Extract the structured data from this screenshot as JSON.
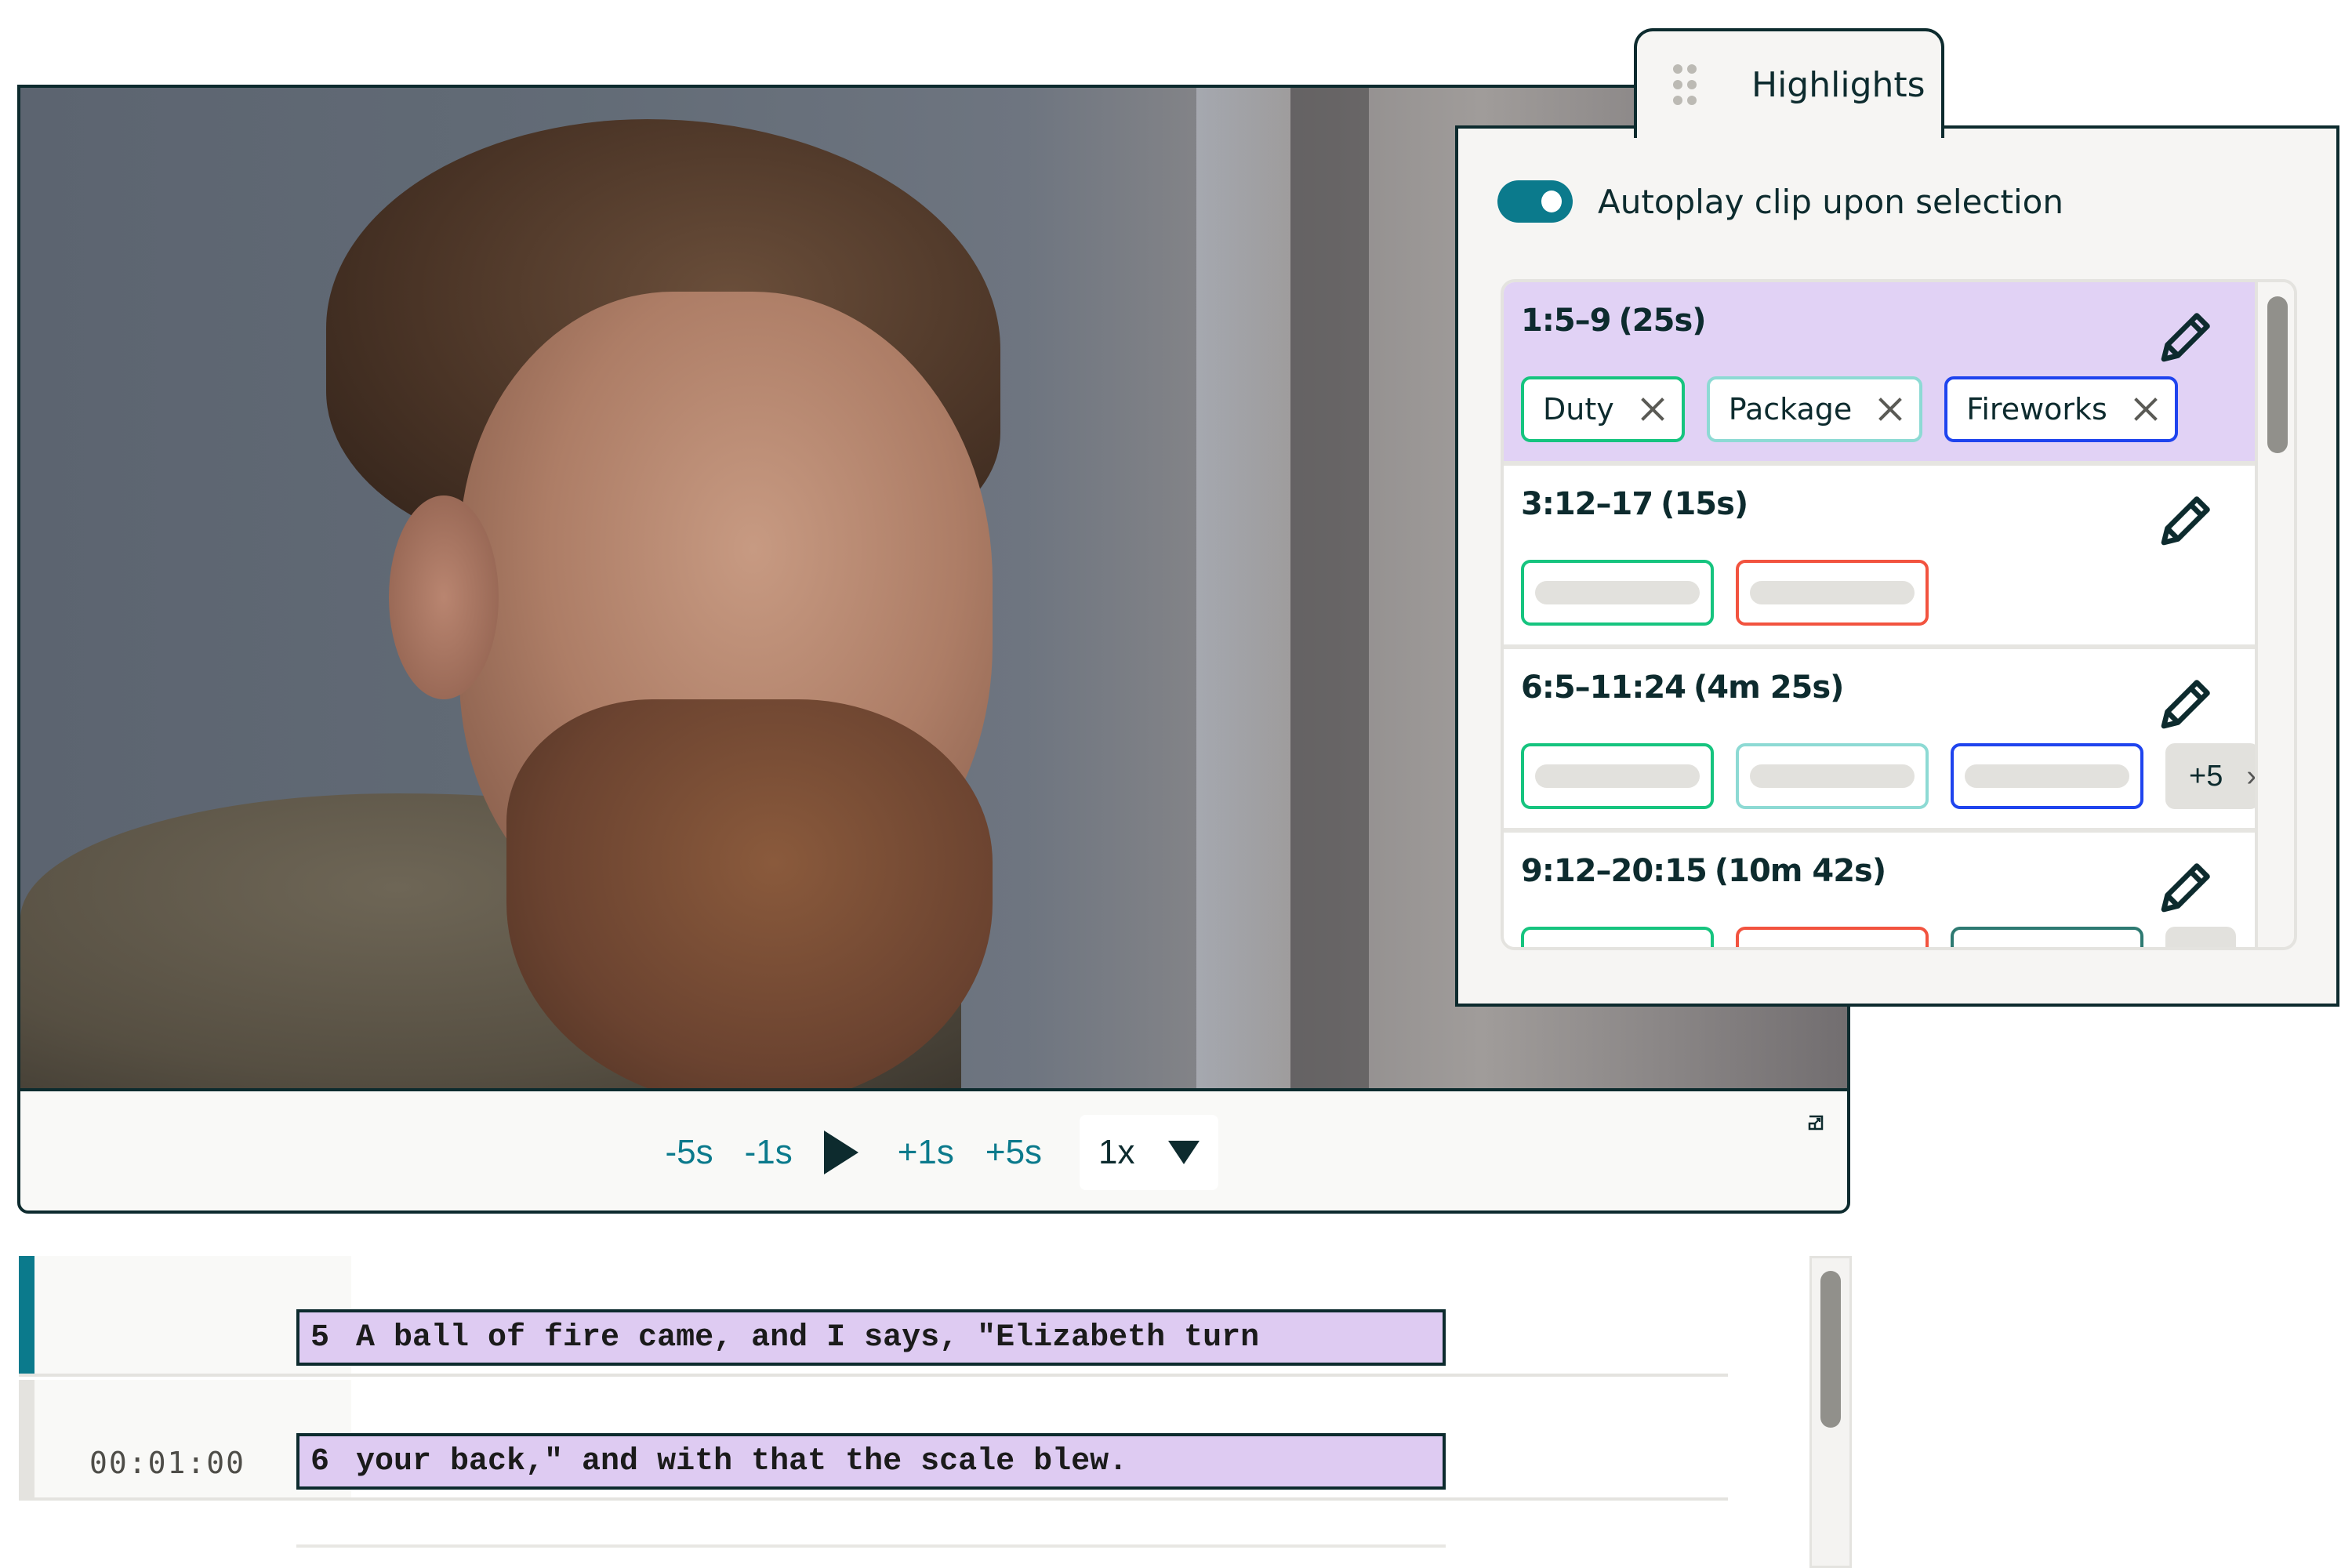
{
  "video": {
    "controls": {
      "back5": "-5s",
      "back1": "-1s",
      "fwd1": "+1s",
      "fwd5": "+5s",
      "speed": "1x",
      "play_icon": "play-icon",
      "popout_icon": "popout-icon"
    }
  },
  "highlights": {
    "tab_title": "Highlights",
    "autoplay_label": "Autoplay clip upon selection",
    "autoplay_on": true,
    "items": [
      {
        "range": "1:5–9",
        "duration": "(25s)",
        "selected": true,
        "tags": [
          {
            "label": "Duty",
            "color": "#16c47f"
          },
          {
            "label": "Package",
            "color": "#8ddad4"
          },
          {
            "label": "Fireworks",
            "color": "#1f44ee"
          }
        ]
      },
      {
        "range": "3:12–17",
        "duration": "(15s)",
        "selected": false,
        "tags": [
          {
            "label": "",
            "color": "#16c47f"
          },
          {
            "label": "",
            "color": "#f2533f"
          }
        ]
      },
      {
        "range": "6:5–11:24",
        "duration": "(4m 25s)",
        "selected": false,
        "tags": [
          {
            "label": "",
            "color": "#16c47f"
          },
          {
            "label": "",
            "color": "#8ddad4"
          },
          {
            "label": "",
            "color": "#1f44ee"
          }
        ],
        "more": "+5"
      },
      {
        "range": "9:12–20:15",
        "duration": "(10m 42s)",
        "selected": false,
        "tags": [
          {
            "label": "",
            "color": "#16c47f"
          },
          {
            "label": "",
            "color": "#f2533f"
          },
          {
            "label": "",
            "color": "#2e7a72"
          }
        ]
      }
    ]
  },
  "transcript": {
    "rows": [
      {
        "timecode": "",
        "line_number": "5",
        "text": "A ball of fire came, and I says, \"Elizabeth turn",
        "active": true
      },
      {
        "timecode": "00:01:00",
        "line_number": "6",
        "text": "your back,\" and with that the scale blew.",
        "active": false
      }
    ]
  },
  "colors": {
    "accent": "#0b7a8c",
    "border": "#0d2b2e",
    "selected_bg": "#e1d2f5",
    "transcript_highlight": "#decbf2"
  }
}
